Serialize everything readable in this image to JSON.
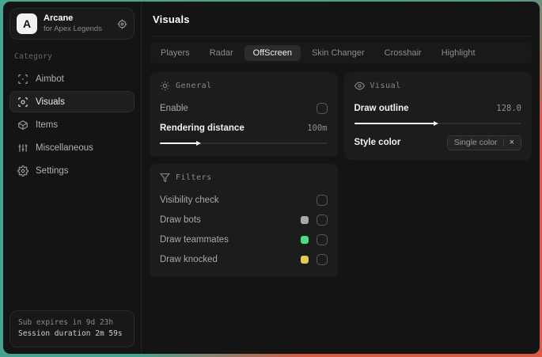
{
  "app": {
    "name": "Arcane",
    "subtitle": "for Apex Legends",
    "logo_letter": "A"
  },
  "sidebar": {
    "category_label": "Category",
    "items": [
      {
        "label": "Aimbot",
        "icon": "crosshair-icon"
      },
      {
        "label": "Visuals",
        "icon": "scan-eye-icon"
      },
      {
        "label": "Items",
        "icon": "package-icon"
      },
      {
        "label": "Miscellaneous",
        "icon": "sliders-icon"
      },
      {
        "label": "Settings",
        "icon": "gear-icon"
      }
    ],
    "footer": {
      "line1": "Sub expires in 9d 23h",
      "line2": "Session duration 2m 59s"
    }
  },
  "header": {
    "title": "Visuals"
  },
  "tabs": [
    {
      "label": "Players"
    },
    {
      "label": "Radar"
    },
    {
      "label": "OffScreen"
    },
    {
      "label": "Skin Changer"
    },
    {
      "label": "Crosshair"
    },
    {
      "label": "Highlight"
    }
  ],
  "panels": {
    "general": {
      "title": "General",
      "enable": {
        "label": "Enable",
        "checked": false
      },
      "rendering": {
        "label": "Rendering distance",
        "value": "100m",
        "percent": 22
      }
    },
    "filters": {
      "title": "Filters",
      "rows": [
        {
          "label": "Visibility check",
          "color": null,
          "checked": false
        },
        {
          "label": "Draw bots",
          "color": "#A8A8A8",
          "checked": false
        },
        {
          "label": "Draw teammates",
          "color": "#4ADE80",
          "checked": false
        },
        {
          "label": "Draw knocked",
          "color": "#E3C94E",
          "checked": false
        }
      ]
    },
    "visual": {
      "title": "Visual",
      "outline": {
        "label": "Draw outline",
        "value": "128.0",
        "percent": 48
      },
      "style_color": {
        "label": "Style color",
        "value": "Single color",
        "clear": "×"
      }
    }
  },
  "colors": {
    "bg_teal": "#45A28E",
    "bg_orange": "#DB5A42",
    "window_bg": "#141414",
    "panel_bg": "#1C1C1C",
    "accent_fill": "#F5F5F5"
  }
}
